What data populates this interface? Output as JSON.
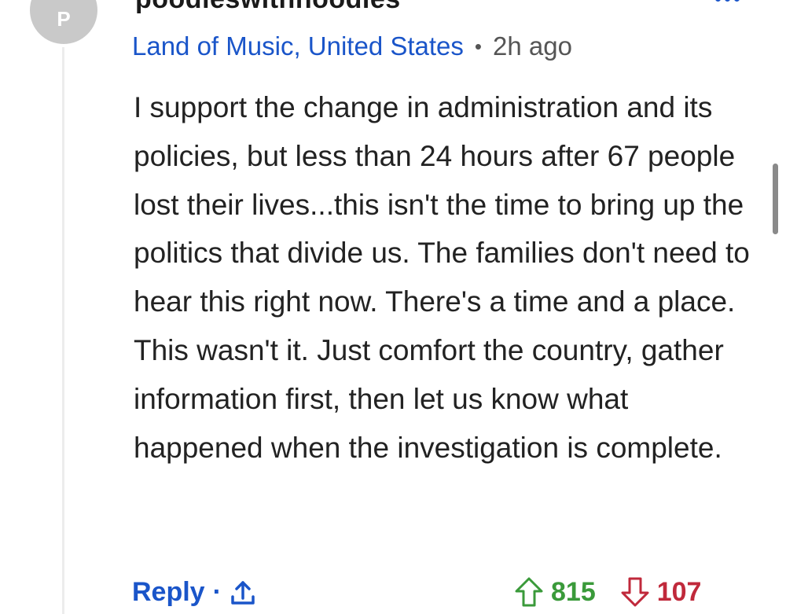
{
  "comment": {
    "avatar_letter": "P",
    "username": "poodleswithhoodies",
    "location": "Land of Music, United States",
    "separator": "•",
    "time": "2h ago",
    "body": "I support the change in administration and its policies, but less than 24 hours after 67 people lost their lives...this isn't the time to bring up the politics that divide us. The families don't need to hear this right now. There's a time and a place. This wasn't it. Just comfort the country, gather information first, then let us know what happened when the investigation is complete."
  },
  "actions": {
    "reply_label": "Reply",
    "separator": "·",
    "share_icon": "share-icon",
    "upvote_icon": "arrow-up-icon",
    "upvote_count": "815",
    "downvote_icon": "arrow-down-icon",
    "downvote_count": "107"
  },
  "colors": {
    "link_blue": "#1a55c9",
    "upvote_green": "#3a9a3a",
    "downvote_red": "#c0293b",
    "avatar_gray": "#c9c9c9"
  }
}
